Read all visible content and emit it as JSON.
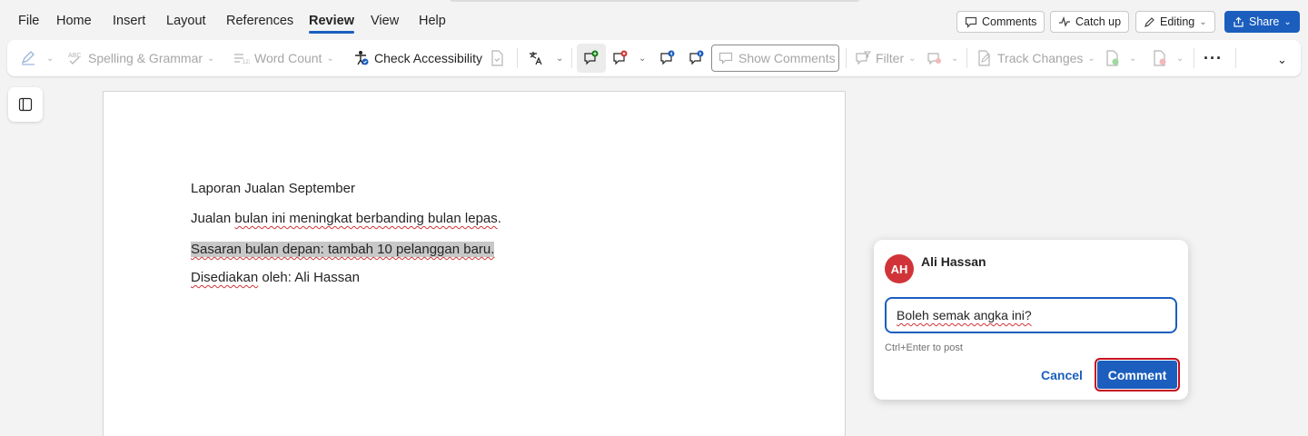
{
  "menu": {
    "items": [
      "File",
      "Home",
      "Insert",
      "Layout",
      "References",
      "Review",
      "View",
      "Help"
    ],
    "active": "Review"
  },
  "top_actions": {
    "comments_label": "Comments",
    "catch_up_label": "Catch up",
    "editing_label": "Editing",
    "share_label": "Share"
  },
  "ribbon": {
    "spelling_label": "Spelling & Grammar",
    "word_count_label": "Word Count",
    "check_accessibility_label": "Check Accessibility",
    "show_comments_label": "Show Comments",
    "filter_label": "Filter",
    "track_changes_label": "Track Changes",
    "more_icon": "···"
  },
  "document": {
    "title": "Laporan Jualan September",
    "line1": {
      "pre": "Jualan ",
      "w1": "bulan ini meningkat berbanding bulan lepas",
      "post": "."
    },
    "line2": "Sasaran bulan depan: tambah 10 pelanggan baru.",
    "line3": {
      "w1": "Disediakan",
      "post": " oleh: Ali Hassan"
    }
  },
  "comment_card": {
    "initials": "AH",
    "author": "Ali Hassan",
    "input_value": "Boleh semak angka ini?",
    "hint": "Ctrl+Enter to post",
    "cancel_label": "Cancel",
    "submit_label": "Comment"
  },
  "colors": {
    "accent": "#1b5ebe",
    "avatar": "#d13438",
    "focus_outline": "#c50f1f"
  }
}
